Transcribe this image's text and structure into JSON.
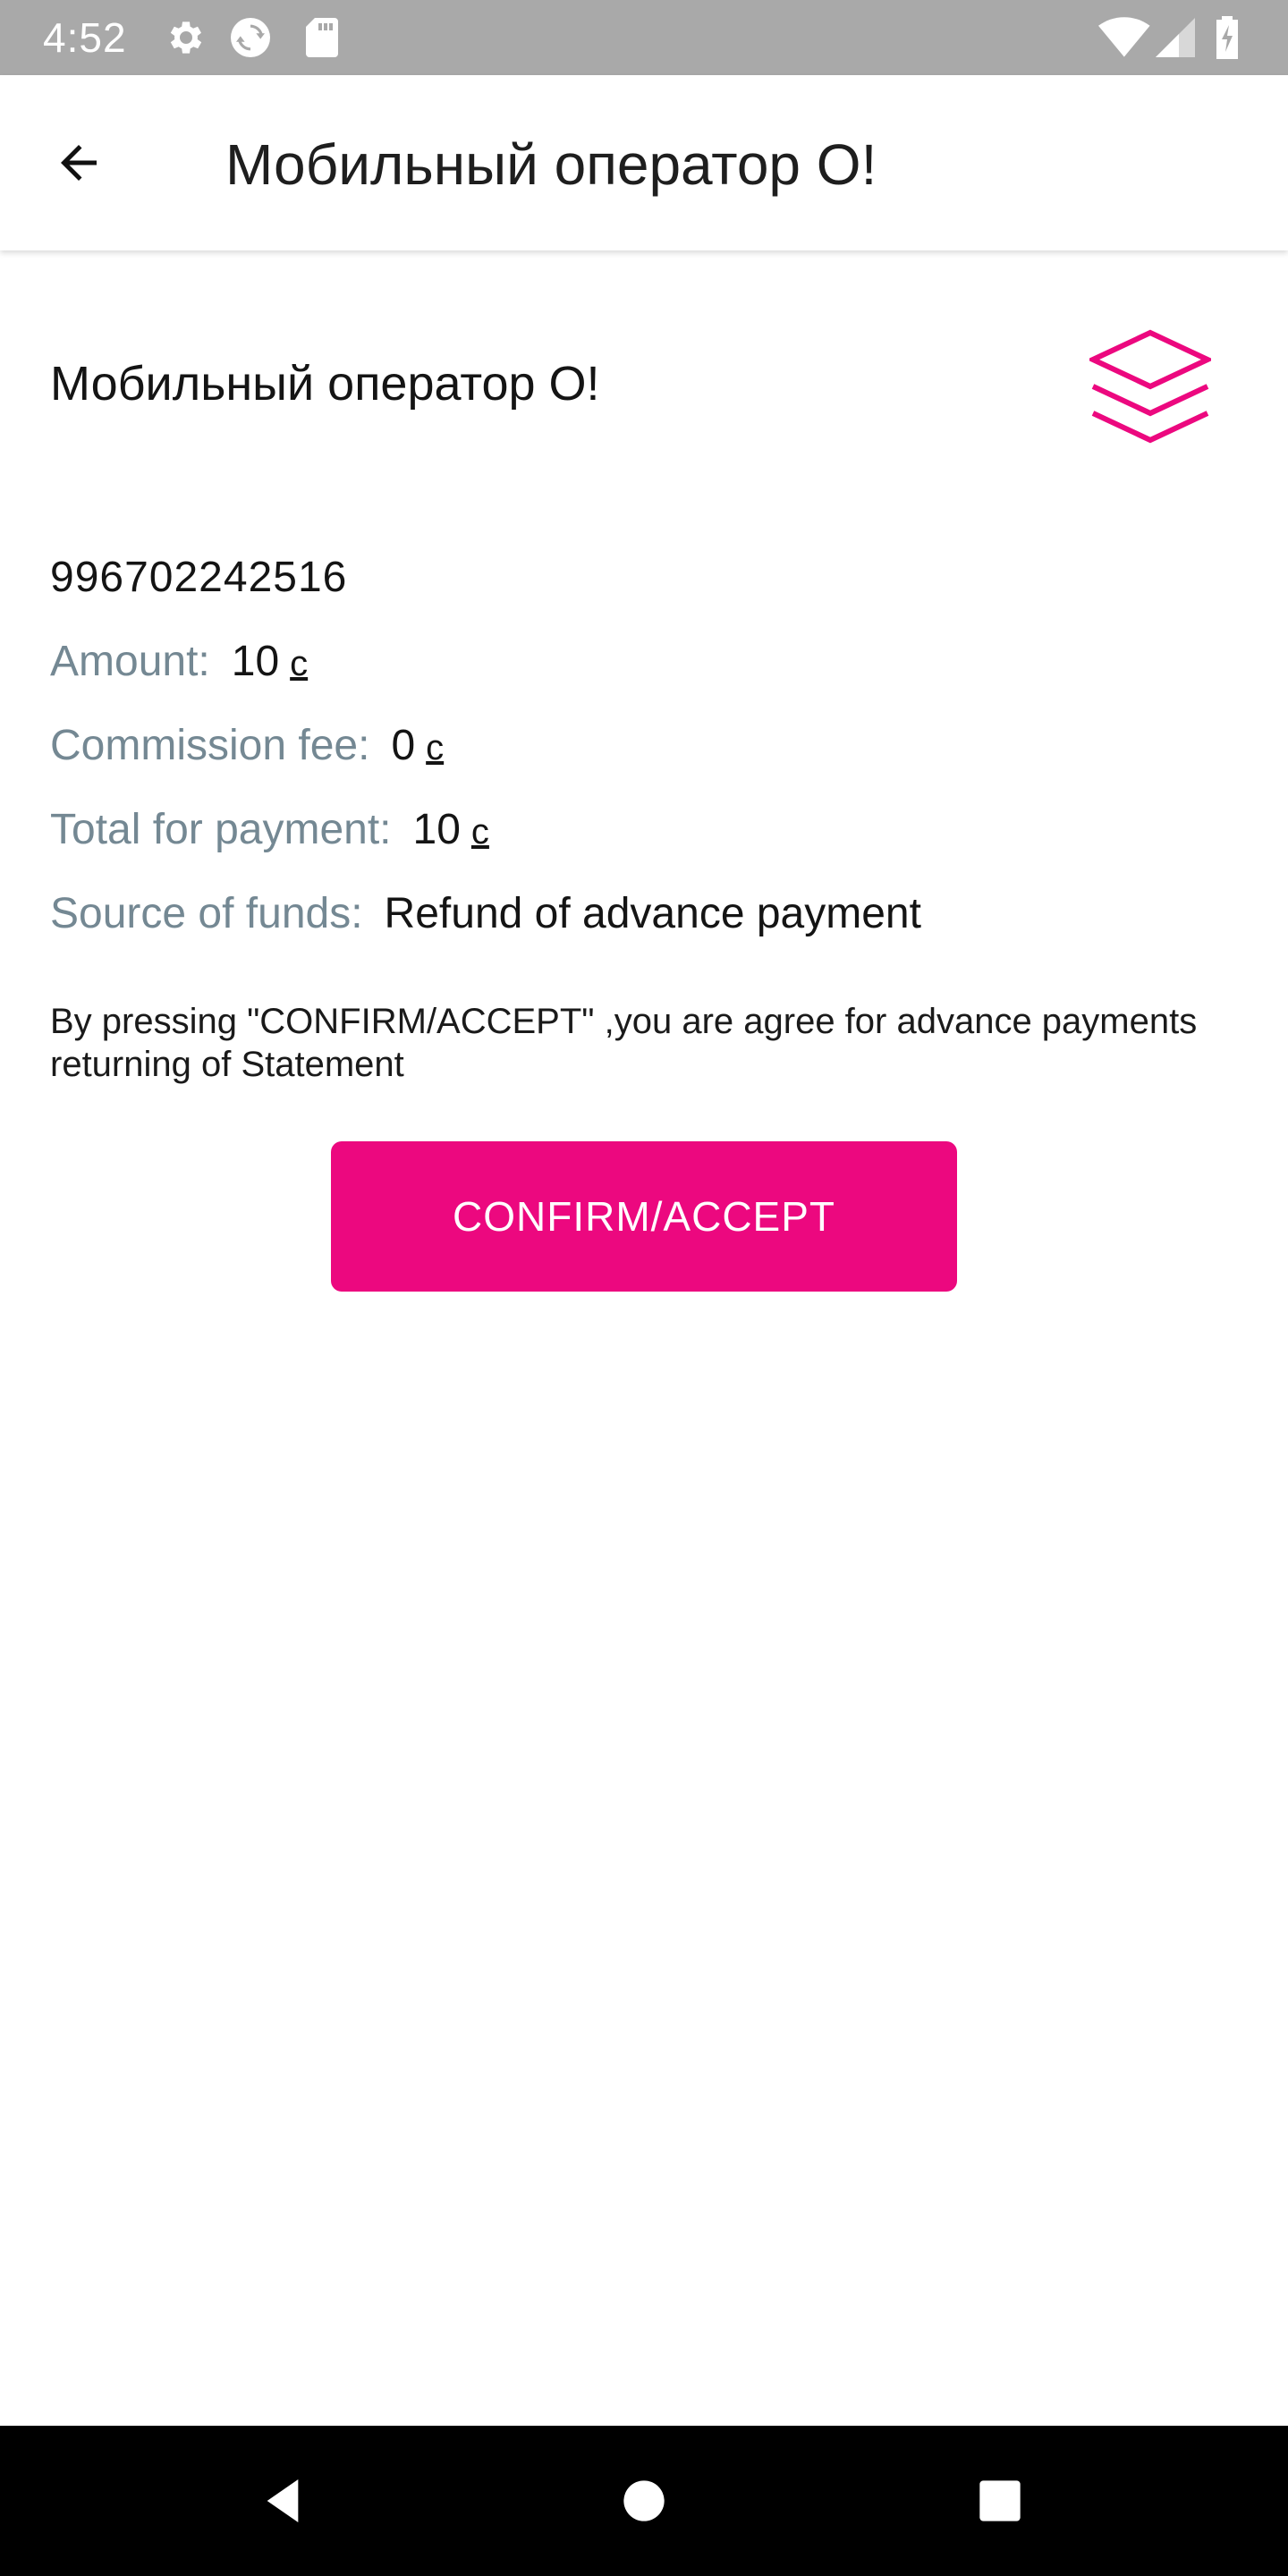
{
  "status_bar": {
    "time": "4:52",
    "icons": [
      "gear-icon",
      "sync-icon",
      "sd-card-icon",
      "wifi-icon",
      "signal-icon",
      "battery-icon"
    ]
  },
  "app_bar": {
    "title": "Мобильный оператор О!",
    "back_icon": "arrow-back-icon"
  },
  "operator": {
    "name": "Мобильный оператор О!",
    "logo_icon": "layers-icon"
  },
  "payment": {
    "phone_number": "996702242516",
    "amount_label": "Amount:",
    "amount_value": "10",
    "amount_currency": "с",
    "fee_label": "Commission fee:",
    "fee_value": "0",
    "fee_currency": "с",
    "total_label": "Total for payment:",
    "total_value": "10",
    "total_currency": "с",
    "source_label": "Source of funds:",
    "source_value": "Refund of advance payment"
  },
  "agreement_text": "By pressing \"CONFIRM/ACCEPT\" ,you are agree for advance payments returning of Statement",
  "confirm_button": "CONFIRM/ACCEPT",
  "colors": {
    "accent": "#ec087f",
    "label": "#748893",
    "status_bar": "#a9a9a9",
    "nav_bar": "#000000"
  },
  "nav_bar": {
    "icons": [
      "nav-back-icon",
      "nav-home-icon",
      "nav-recents-icon"
    ]
  }
}
